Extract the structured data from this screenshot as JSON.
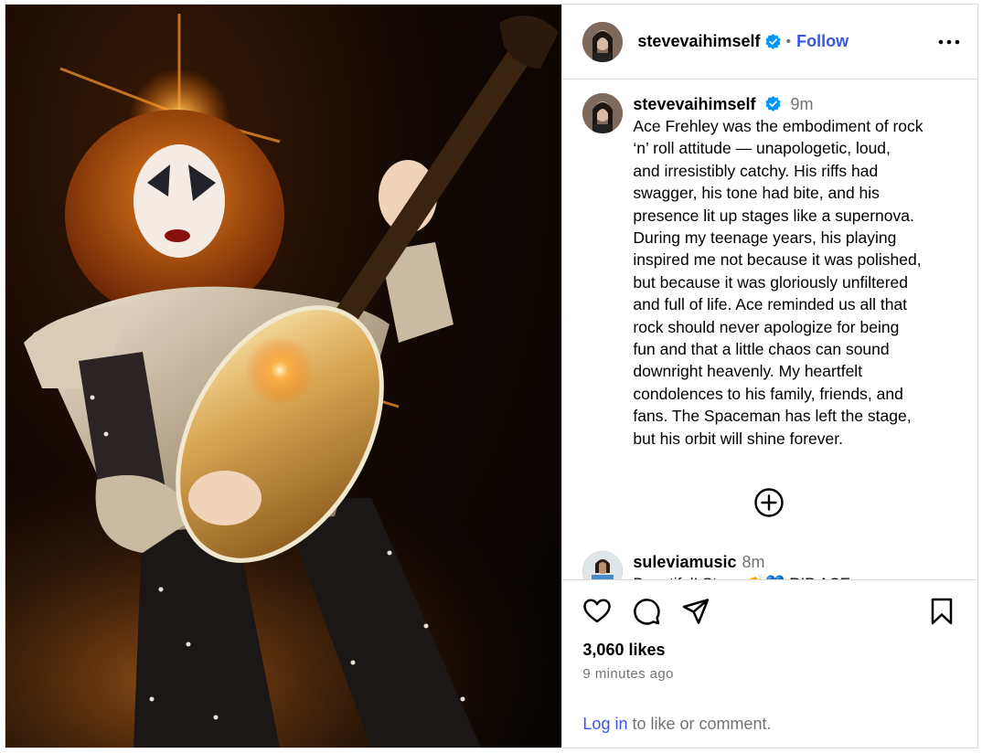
{
  "post": {
    "author": "stevevaihimself",
    "follow_label": "Follow",
    "separator": "•",
    "caption_time": "9m",
    "caption": "Ace Frehley was the embodiment of rock\n‘n’ roll attitude — unapologetic, loud,\nand irresistibly catchy. His riffs had\nswagger, his tone had bite, and his\npresence lit up stages like a supernova.\nDuring my teenage years, his playing\ninspired me not because it was polished,\nbut because it was gloriously unfiltered\nand full of life. Ace reminded us all that\nrock should never apologize for being\nfun and that a little chaos can sound\ndownright heavenly. My heartfelt\ncondolences to his family, friends, and\nfans. The Spaceman has left the stage,\nbut his orbit will shine forever."
  },
  "comment": {
    "author": "suleviamusic",
    "time": "8m",
    "text_partial": "Beautiful! Steve 👏💙 RIP ACE"
  },
  "stats": {
    "likes": "3,060 likes",
    "time_ago": "9 minutes ago"
  },
  "footer": {
    "login_link": "Log in",
    "login_rest": " to like or comment."
  },
  "icons": {
    "verified": "verified-badge-icon",
    "more": "more-options-icon",
    "like": "heart-icon",
    "comment": "comment-icon",
    "share": "share-icon",
    "save": "bookmark-icon",
    "load_more": "plus-circle-icon"
  },
  "colors": {
    "accent": "#3a56e6",
    "verified": "#0095f6",
    "muted": "#737373",
    "border": "#dbdbdb"
  }
}
